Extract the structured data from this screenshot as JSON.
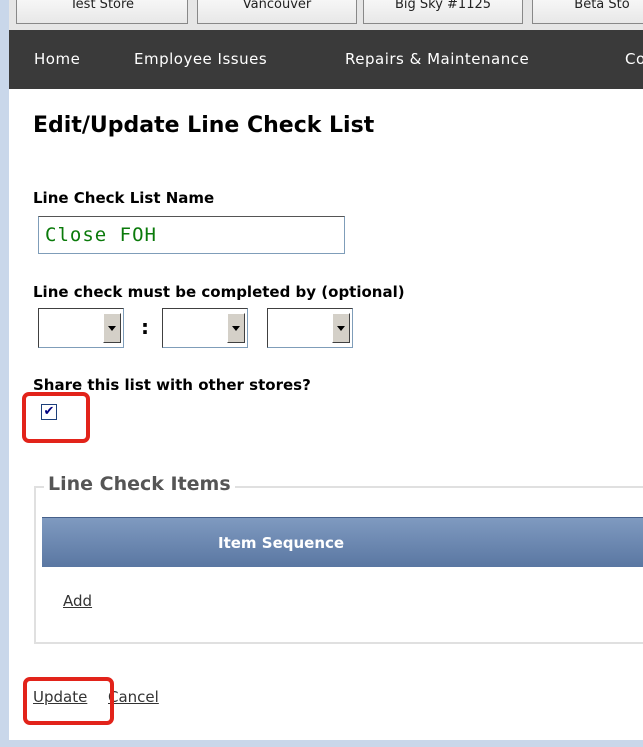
{
  "store_tabs": [
    "Test Store",
    "Vancouver",
    "Big Sky #1125",
    "Beta Sto"
  ],
  "nav": {
    "items": [
      "Home",
      "Employee Issues",
      "Repairs & Maintenance",
      "Co"
    ]
  },
  "form": {
    "title": "Edit/Update Line Check List",
    "name_label": "Line Check List Name",
    "name_value": "Close FOH",
    "completed_by_label": "Line check must be completed by (optional)",
    "time_separator": ":",
    "hour_value": "",
    "minute_value": "",
    "ampm_value": "",
    "share_label": "Share this list with other stores?",
    "share_checked": true,
    "share_check_glyph": "✔"
  },
  "items_section": {
    "legend": "Line Check Items",
    "column_header": "Item Sequence",
    "add_link": "Add"
  },
  "actions": {
    "update": "Update",
    "cancel": "Cancel"
  },
  "colors": {
    "nav_bg": "#3a3a3a",
    "gutter": "#c9d7ea",
    "table_header": "#6a86b0",
    "highlight_ring": "#e2231a",
    "name_text": "#0a7a0a"
  },
  "icons": {
    "dropdown": "chevron-down-icon",
    "checkbox": "checkmark-icon"
  }
}
